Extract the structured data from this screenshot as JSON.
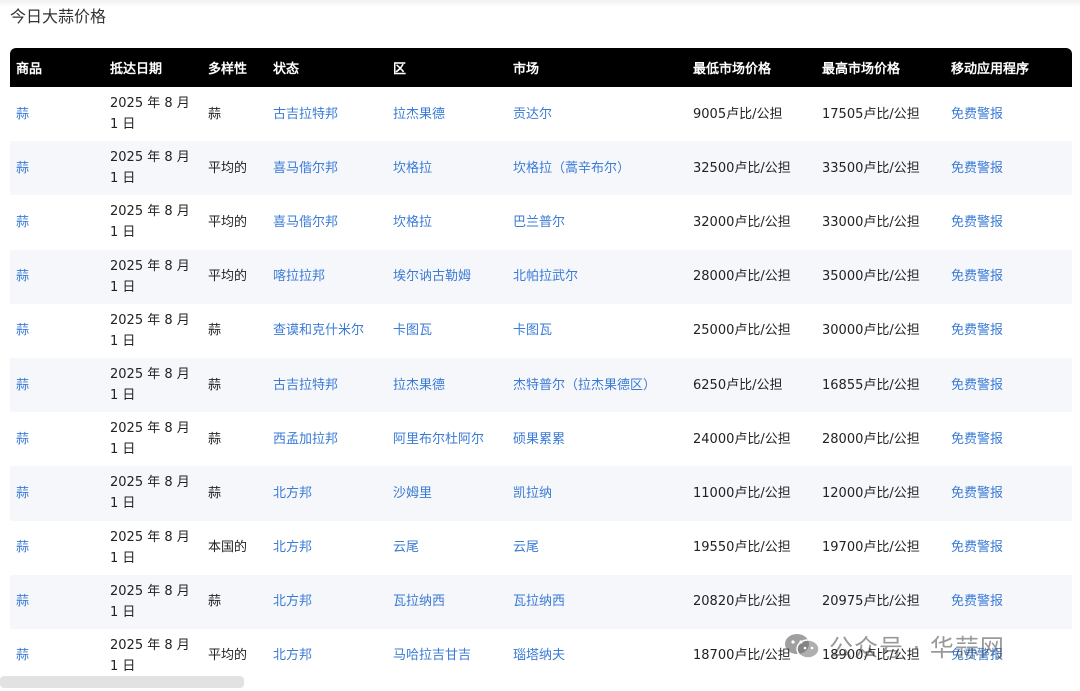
{
  "page": {
    "title": "今日大蒜价格"
  },
  "table": {
    "headers": [
      "商品",
      "抵达日期",
      "多样性",
      "状态",
      "区",
      "市场",
      "最低市场价格",
      "最高市场价格",
      "移动应用程序"
    ],
    "rows": [
      {
        "commodity": "蒜",
        "date": "2025 年 8 月 1 日",
        "variety": "蒜",
        "state": "古吉拉特邦",
        "district": "拉杰果德",
        "market": "贡达尔",
        "min": "9005卢比/公担",
        "max": "17505卢比/公担",
        "app": "免费警报"
      },
      {
        "commodity": "蒜",
        "date": "2025 年 8 月 1 日",
        "variety": "平均的",
        "state": "喜马偕尔邦",
        "district": "坎格拉",
        "market": "坎格拉（蒿辛布尔）",
        "min": "32500卢比/公担",
        "max": "33500卢比/公担",
        "app": "免费警报"
      },
      {
        "commodity": "蒜",
        "date": "2025 年 8 月 1 日",
        "variety": "平均的",
        "state": "喜马偕尔邦",
        "district": "坎格拉",
        "market": "巴兰普尔",
        "min": "32000卢比/公担",
        "max": "33000卢比/公担",
        "app": "免费警报"
      },
      {
        "commodity": "蒜",
        "date": "2025 年 8 月 1 日",
        "variety": "平均的",
        "state": "喀拉拉邦",
        "district": "埃尔讷古勒姆",
        "market": "北帕拉武尔",
        "min": "28000卢比/公担",
        "max": "35000卢比/公担",
        "app": "免费警报"
      },
      {
        "commodity": "蒜",
        "date": "2025 年 8 月 1 日",
        "variety": "蒜",
        "state": "查谟和克什米尔",
        "district": "卡图瓦",
        "market": "卡图瓦",
        "min": "25000卢比/公担",
        "max": "30000卢比/公担",
        "app": "免费警报"
      },
      {
        "commodity": "蒜",
        "date": "2025 年 8 月 1 日",
        "variety": "蒜",
        "state": "古吉拉特邦",
        "district": "拉杰果德",
        "market": "杰特普尔（拉杰果德区）",
        "min": "6250卢比/公担",
        "max": "16855卢比/公担",
        "app": "免费警报"
      },
      {
        "commodity": "蒜",
        "date": "2025 年 8 月 1 日",
        "variety": "蒜",
        "state": "西孟加拉邦",
        "district": "阿里布尔杜阿尔",
        "market": "硕果累累",
        "min": "24000卢比/公担",
        "max": "28000卢比/公担",
        "app": "免费警报"
      },
      {
        "commodity": "蒜",
        "date": "2025 年 8 月 1 日",
        "variety": "蒜",
        "state": "北方邦",
        "district": "沙姆里",
        "market": "凯拉纳",
        "min": "11000卢比/公担",
        "max": "12000卢比/公担",
        "app": "免费警报"
      },
      {
        "commodity": "蒜",
        "date": "2025 年 8 月 1 日",
        "variety": "本国的",
        "state": "北方邦",
        "district": "云尾",
        "market": "云尾",
        "min": "19550卢比/公担",
        "max": "19700卢比/公担",
        "app": "免费警报"
      },
      {
        "commodity": "蒜",
        "date": "2025 年 8 月 1 日",
        "variety": "蒜",
        "state": "北方邦",
        "district": "瓦拉纳西",
        "market": "瓦拉纳西",
        "min": "20820卢比/公担",
        "max": "20975卢比/公担",
        "app": "免费警报"
      },
      {
        "commodity": "蒜",
        "date": "2025 年 8 月 1 日",
        "variety": "平均的",
        "state": "北方邦",
        "district": "马哈拉吉甘吉",
        "market": "瑙塔纳夫",
        "min": "18700卢比/公担",
        "max": "18900卢比/公担",
        "app": "免费警报"
      }
    ]
  },
  "watermark": {
    "text": "公众号 · 华蒜网",
    "icon": "wechat-icon"
  },
  "colors": {
    "link": "#3a7bd5",
    "header_bg": "#000000",
    "stripe": "#f6f7fb"
  }
}
